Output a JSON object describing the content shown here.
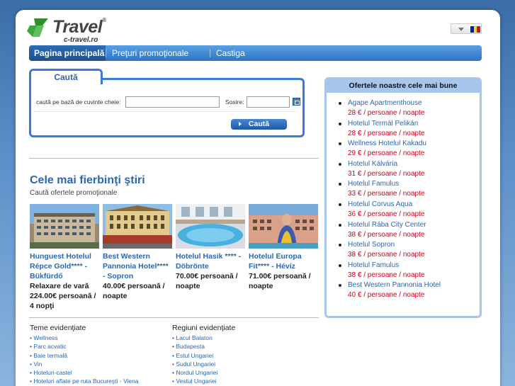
{
  "brand": {
    "name": "Travel",
    "registered": "®",
    "domain": "c-travel.ro"
  },
  "language": {
    "flag_colors": [
      "#002b7f",
      "#fcd116",
      "#ce1126"
    ]
  },
  "nav": {
    "tabs": [
      {
        "label": "Pagina principală",
        "active": true
      },
      {
        "label": "Preţuri promoţionale",
        "active": false
      },
      {
        "label": "Castiga",
        "active": false
      }
    ]
  },
  "search": {
    "tab_label": "Caută",
    "keyword_label": "caută pe bază de cuvinte cheie:",
    "keyword_value": "",
    "arrival_label": "Sosire:",
    "arrival_value": "",
    "button_label": "Caută"
  },
  "news": {
    "title": "Cele mai fierbinţi ştiri",
    "subtitle": "Caută ofertele promoţionale",
    "cards": [
      {
        "name": "Hunguest Hotelul Répce Gold**** - Bükfürdő",
        "price": "Relaxare de vară 224.00€ persoană / 4 nopţi"
      },
      {
        "name": "Best Western Pannonia Hotel**** - Sopron",
        "price": "40.00€ persoană / noapte"
      },
      {
        "name": "Hotelul Hasik **** - Döbrönte",
        "price": "70.00€ persoană / noapte"
      },
      {
        "name": "Hotelul Europa Fit**** - Hévíz",
        "price": "71.00€ persoană / noapte"
      }
    ]
  },
  "featured_themes": {
    "title": "Teme evidenţiate",
    "items": [
      "• Wellness",
      "• Parc acvatic",
      "• Baie termală",
      "• Vin",
      "• Hoteluri-castel",
      "• Hoteluri aflate pe ruta Bucureşti - Viena"
    ]
  },
  "featured_regions": {
    "title": "Regiuni evidenţiate",
    "items": [
      "• Lacul Balaton",
      "• Budapesta",
      "• Estul Ungariei",
      "• Sudul Ungariei",
      "• Nordul Ungariei",
      "• Vestul Ungariei"
    ]
  },
  "offers": {
    "title": "Ofertele noastre cele mai bune",
    "items": [
      {
        "name": "Agape Apartmenthouse",
        "price": "28 € / persoane / noapte"
      },
      {
        "name": "Hotelul Termál Pelikán",
        "price": "28 € / persoane / noapte"
      },
      {
        "name": "Wellness Hotelul Kakadu",
        "price": "29 € / persoane / noapte"
      },
      {
        "name": "Hotelul Kálvária",
        "price": "31 € / persoane / noapte"
      },
      {
        "name": "Hotelul Famulus",
        "price": "33 € / persoane / noapte"
      },
      {
        "name": "Hotelul Corvus Aqua",
        "price": "36 € / persoane / noapte"
      },
      {
        "name": "Hotelul Rába City Center",
        "price": "38 € / persoane / noapte"
      },
      {
        "name": "Hotelul Sopron",
        "price": "38 € / persoane / noapte"
      },
      {
        "name": "Hotelul Famulus",
        "price": "38 € / persoane / noapte"
      },
      {
        "name": "Best Western Pannonia Hotel",
        "price": "40 € / persoane / noapte"
      }
    ]
  }
}
